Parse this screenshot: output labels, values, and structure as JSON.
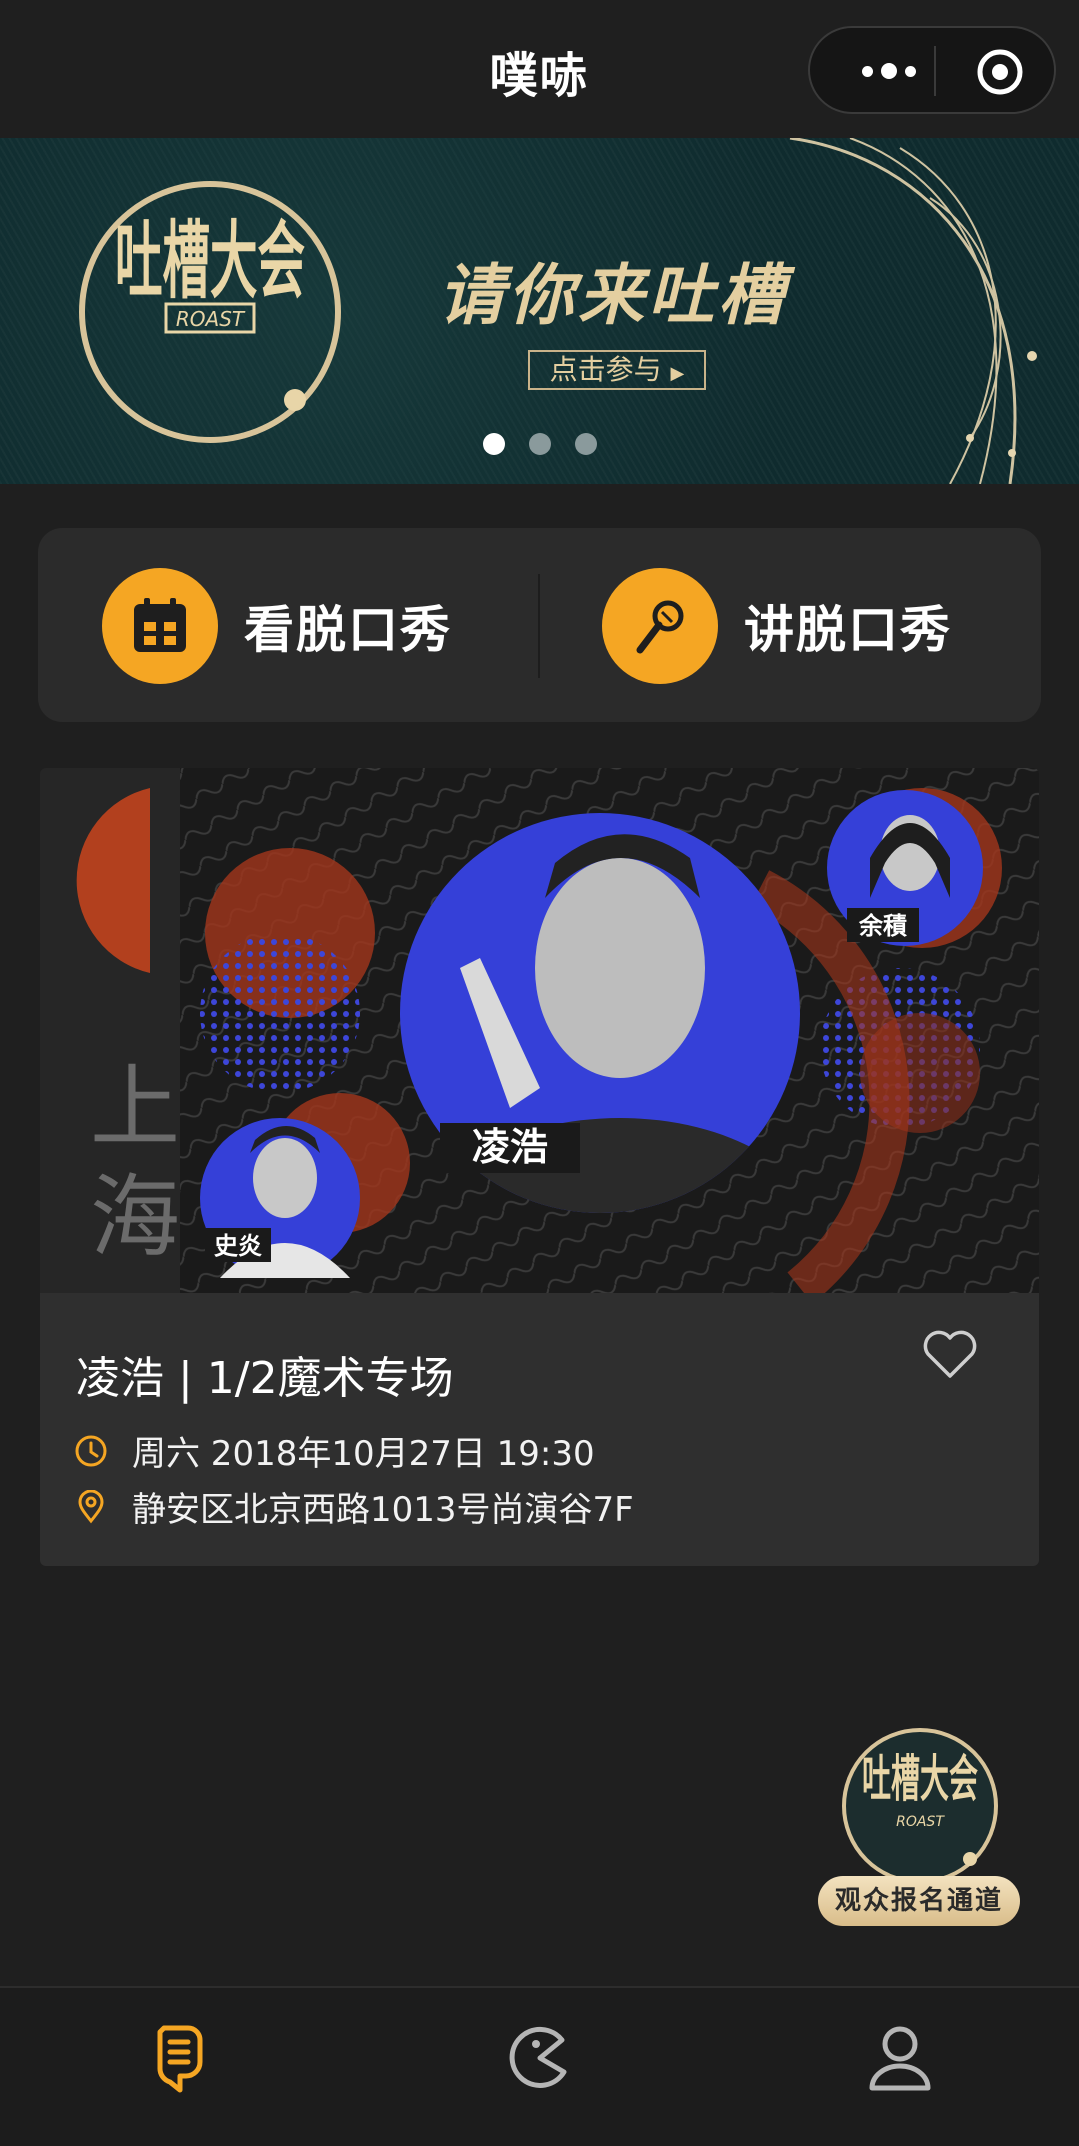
{
  "header": {
    "title": "噗哧"
  },
  "banner": {
    "logo_text_cn": "吐槽大会",
    "logo_text_en": "ROAST",
    "headline": "请你来吐槽",
    "cta_label": "点击参与",
    "slide_count": 3,
    "active_slide": 1
  },
  "actions": {
    "watch_label": "看脱口秀",
    "perform_label": "讲脱口秀"
  },
  "show": {
    "poster": {
      "city": "上海",
      "main_performer": "凌浩",
      "guest_left": "史炎",
      "guest_right": "余積"
    },
    "title": "凌浩 | 1/2魔术专场",
    "datetime": "周六 2018年10月27日 19:30",
    "location": "静安区北京西路1013号尚演谷7F"
  },
  "floating_badge": {
    "logo_text_cn": "吐槽大会",
    "logo_text_en": "ROAST",
    "label": "观众报名通道"
  },
  "tabbar": {
    "active_index": 0,
    "tabs": [
      {
        "icon": "microphone-icon"
      },
      {
        "icon": "discover-icon"
      },
      {
        "icon": "profile-icon"
      }
    ]
  },
  "colors": {
    "accent": "#f5a623",
    "background": "#1f1f1f",
    "card": "#2f2f2f",
    "banner_bg": "#0f2b2e",
    "gold": "#e4cfa0"
  }
}
